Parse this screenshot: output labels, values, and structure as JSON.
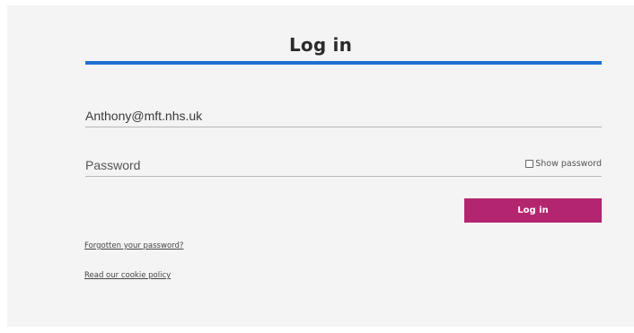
{
  "login_form": {
    "title": "Log in",
    "email_value": "Anthony@mft.nhs.uk",
    "password_placeholder": "Password",
    "show_password_label": "Show password",
    "show_password_checked": false,
    "submit_label": "Log in",
    "forgot_password_link": "Forgotten your password?",
    "cookie_policy_link": "Read our cookie policy"
  },
  "colors": {
    "accent_blue": "#1f6fd1",
    "button_magenta": "#b3266f",
    "panel_background": "#f4f4f4"
  }
}
